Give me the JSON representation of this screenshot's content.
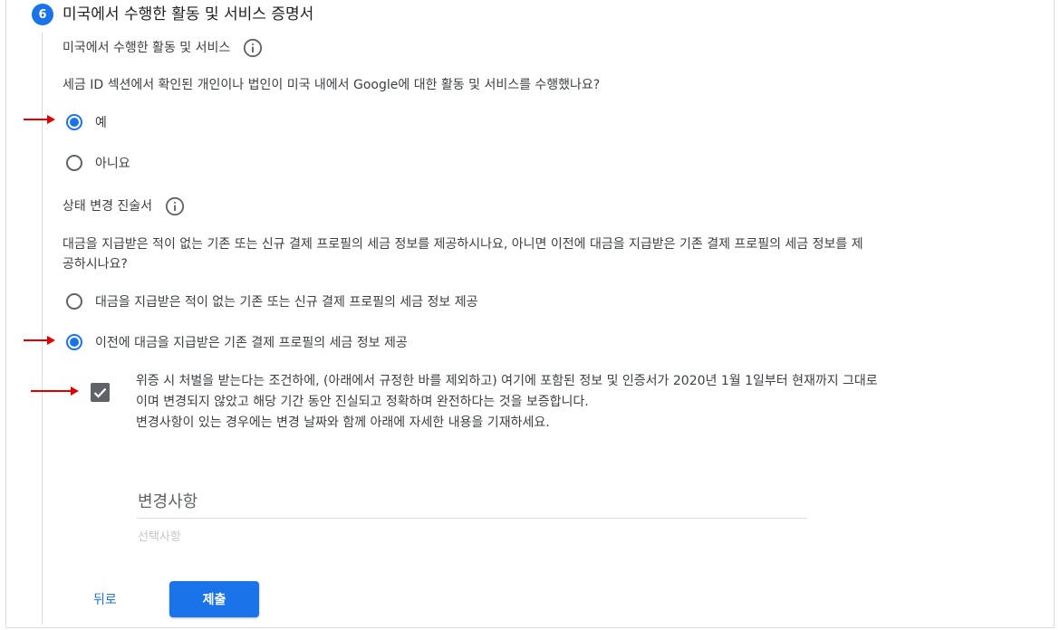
{
  "step": {
    "number": "6",
    "title": "미국에서 수행한 활동 및 서비스 증명서"
  },
  "activities": {
    "heading": "미국에서 수행한 활동 및 서비스",
    "question": "세금 ID 섹션에서 확인된 개인이나 법인이 미국 내에서 Google에 대한 활동 및 서비스를 수행했나요?",
    "options": [
      {
        "label": "예",
        "checked": true
      },
      {
        "label": "아니요",
        "checked": false
      }
    ]
  },
  "status_change": {
    "heading": "상태 변경 진술서",
    "question_line1": "대금을 지급받은 적이 없는 기존 또는 신규 결제 프로필의 세금 정보를 제공하시나요, 아니면 이전에 대금을 지급받은 기존 결제 프로필의 세금 정보를 제",
    "question_line2": "공하시나요?",
    "options": [
      {
        "label": "대금을 지급받은 적이 없는 기존 또는 신규 결제 프로필의 세금 정보 제공",
        "checked": false
      },
      {
        "label": "이전에 대금을 지급받은 기존 결제 프로필의 세금 정보 제공",
        "checked": true
      }
    ]
  },
  "certification": {
    "checked": true,
    "line1": "위증 시 처벌을 받는다는 조건하에, (아래에서 규정한 바를 제외하고) 여기에 포함된 정보 및 인증서가 2020년 1월 1일부터 현재까지 그대로",
    "line2": "이며 변경되지 않았고 해당 기간 동안 진실되고 정확하며 완전하다는 것을 보증합니다.",
    "line3": "변경사항이 있는 경우에는 변경 날짜와 함께 아래에 자세한 내용을 기재하세요."
  },
  "changes_field": {
    "label": "변경사항",
    "hint": "선택사항"
  },
  "actions": {
    "back": "뒤로",
    "submit": "제출"
  },
  "colors": {
    "accent": "#1a73e8",
    "annotation_arrow": "#e00000"
  },
  "icons": {
    "info": "info-icon",
    "check": "check-icon",
    "arrow": "red-arrow-icon"
  }
}
